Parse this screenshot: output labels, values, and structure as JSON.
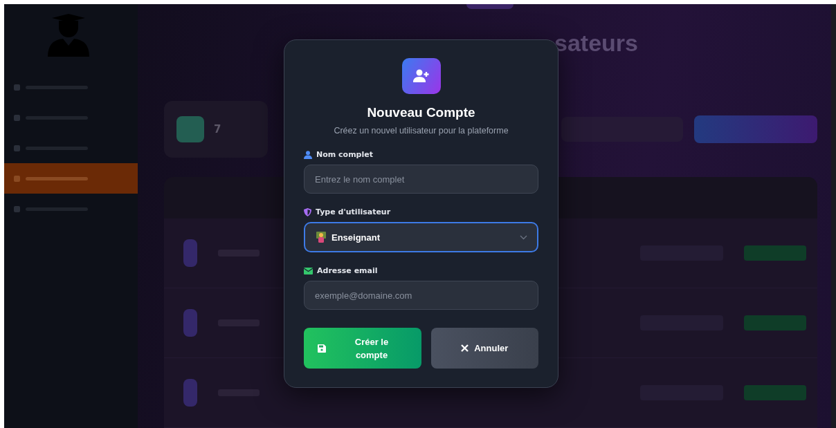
{
  "sidebar": {
    "items": [
      {
        "selected": false
      },
      {
        "selected": false
      },
      {
        "selected": false
      },
      {
        "selected": true
      },
      {
        "selected": false
      }
    ]
  },
  "page": {
    "heading_fragment": "sateurs",
    "stat_value": "7"
  },
  "modal": {
    "title": "Nouveau Compte",
    "subtitle": "Créez un nouvel utilisateur pour la plateforme",
    "fields": [
      {
        "kind": "text",
        "label": "Nom complet",
        "placeholder": "Entrez le nom complet"
      },
      {
        "kind": "select",
        "label": "Type d'utilisateur",
        "value": "Enseignant",
        "focused": true
      },
      {
        "kind": "email",
        "label": "Adresse email",
        "placeholder": "exemple@domaine.com"
      }
    ],
    "buttons": [
      {
        "kind": "submit",
        "label": "Créer le compte"
      },
      {
        "kind": "cancel",
        "label": "Annuler"
      }
    ]
  }
}
